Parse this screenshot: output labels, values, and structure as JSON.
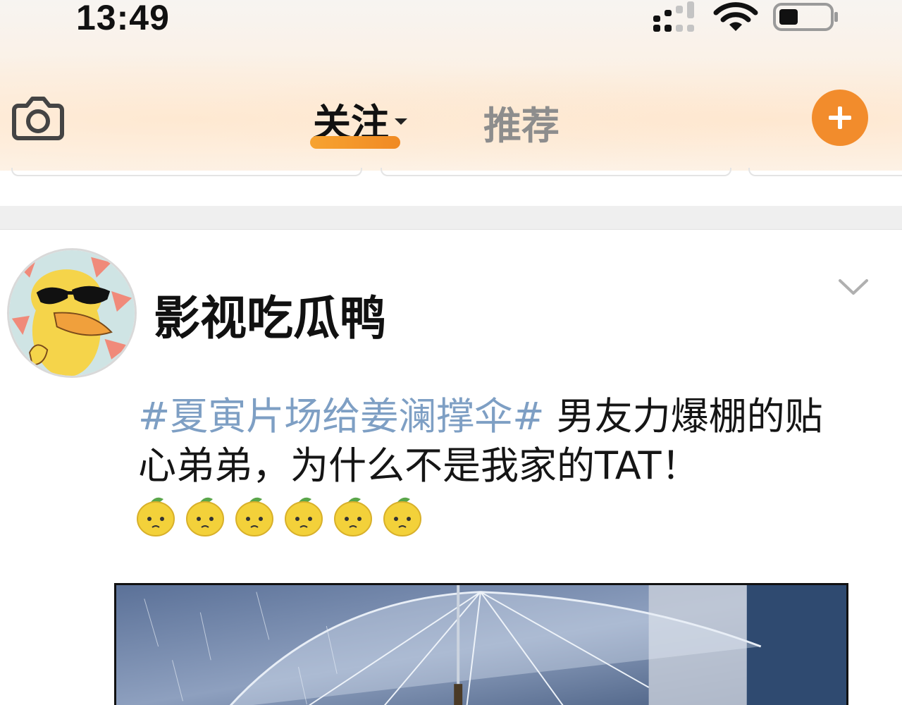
{
  "status_bar": {
    "time": "13:49"
  },
  "nav": {
    "tabs": [
      {
        "label": "关注",
        "active": true
      },
      {
        "label": "推荐",
        "active": false
      }
    ],
    "accent_color": "#f28c2c"
  },
  "post": {
    "username": "影视吃瓜鸭",
    "hashtag": "#夏寅片场给姜澜撑伞#",
    "text": " 男友力爆棚的贴心弟弟，为什么不是我家的TAT！",
    "emoji_icons": [
      "lemon-emoji",
      "lemon-emoji",
      "lemon-emoji",
      "lemon-emoji",
      "lemon-emoji",
      "lemon-emoji"
    ],
    "hashtag_color": "#7e9fc4"
  }
}
